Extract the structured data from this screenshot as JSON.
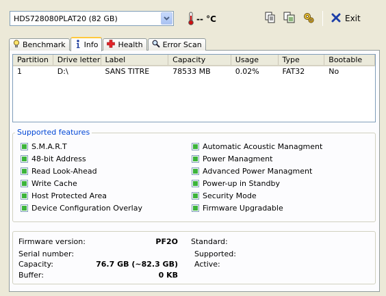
{
  "drive_selector": {
    "value": "HDS728080PLAT20 (82 GB)"
  },
  "temperature": {
    "value": "-- °C"
  },
  "toolbar": {
    "exit_label": "Exit"
  },
  "tabs": [
    {
      "label": "Benchmark",
      "icon": "lightbulb-icon"
    },
    {
      "label": "Info",
      "icon": "info-icon",
      "active": true
    },
    {
      "label": "Health",
      "icon": "health-cross-icon"
    },
    {
      "label": "Error Scan",
      "icon": "magnifier-icon"
    }
  ],
  "partition_table": {
    "columns": [
      "Partition",
      "Drive letter",
      "Label",
      "Capacity",
      "Usage",
      "Type",
      "Bootable"
    ],
    "rows": [
      [
        "1",
        "D:\\",
        "SANS TITRE",
        "78533 MB",
        "0.02%",
        "FAT32",
        "No"
      ]
    ]
  },
  "features": {
    "title": "Supported features",
    "left": [
      "S.M.A.R.T",
      "48-bit Address",
      "Read Look-Ahead",
      "Write Cache",
      "Host Protected Area",
      "Device Configuration Overlay"
    ],
    "right": [
      "Automatic Acoustic Managment",
      "Power Managment",
      "Advanced Power Managment",
      "Power-up in Standby",
      "Security Mode",
      "Firmware Upgradable"
    ]
  },
  "info": {
    "firmware_label": "Firmware version:",
    "firmware_value": "PF2O",
    "serial_label": "Serial number:",
    "serial_value": "",
    "capacity_label": "Capacity:",
    "capacity_value": "76.7 GB (~82.3 GB)",
    "buffer_label": "Buffer:",
    "buffer_value": "0 KB",
    "standard_label": "Standard:",
    "supported_label": "Supported:",
    "active_label": "Active:"
  },
  "colors": {
    "feature_check": "#3cb43c",
    "group_title": "#0046d5",
    "active_tab_accent": "#ffc83c"
  }
}
